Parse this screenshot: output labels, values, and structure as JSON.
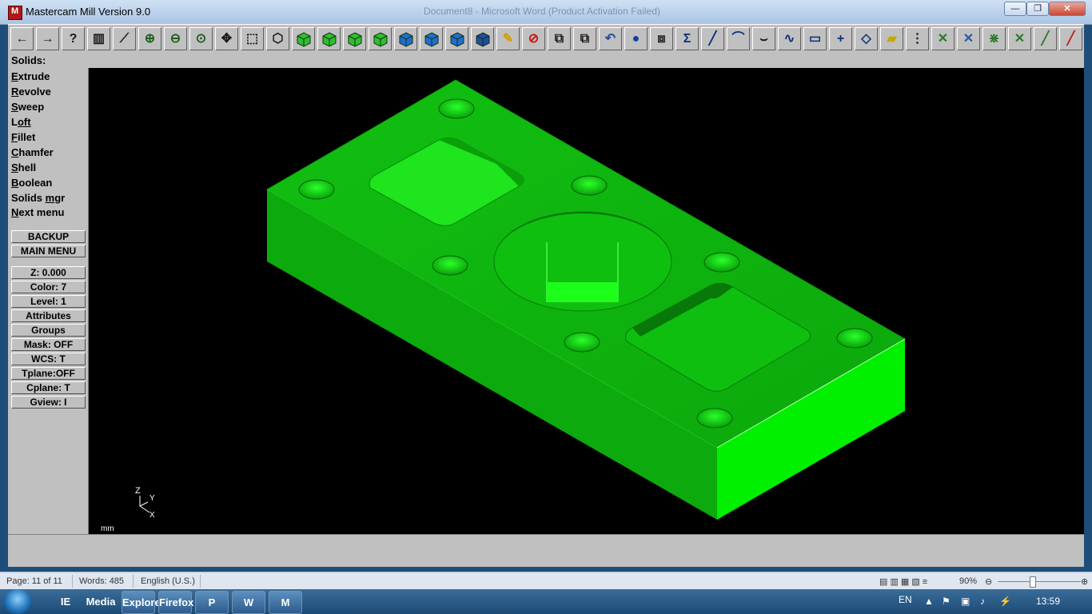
{
  "window": {
    "title": "Mastercam Mill Version 9.0",
    "background_title": "Document8 - Microsoft Word (Product Activation Failed)",
    "controls": [
      "—",
      "❐",
      "✕"
    ]
  },
  "toolbar": {
    "icons": [
      "back-arrow-icon",
      "forward-arrow-icon",
      "help-icon",
      "file-icon",
      "analyze-icon",
      "zoom-icon",
      "unzoom-icon",
      "zoom-fit-icon",
      "pan-icon",
      "select-window-icon",
      "view-top-icon",
      "cube-iso-icon",
      "cube-top-icon",
      "cube-front-icon",
      "cube-side-icon",
      "cube-blue-1-icon",
      "cube-blue-2-icon",
      "cube-blue-3-icon",
      "cube-outline-icon",
      "pencil-icon",
      "no-entry-icon",
      "transform-icon",
      "transform2-icon",
      "undo-icon",
      "sphere-icon",
      "layers-icon",
      "sigma-icon",
      "line-icon",
      "arc-icon",
      "trim-icon",
      "spline-icon",
      "rectangle-icon",
      "point-icon",
      "plane-icon",
      "box-icon",
      "tree-icon",
      "x-icon",
      "x2-icon",
      "x3-icon",
      "x4-icon",
      "dim-icon",
      "dim2-icon"
    ]
  },
  "prompt": {
    "label": "Solids:"
  },
  "menu": [
    {
      "label": "Extrude",
      "hot": "E",
      "rest": "xtrude"
    },
    {
      "label": "Revolve",
      "hot": "R",
      "rest": "evolve"
    },
    {
      "label": "Sweep",
      "hot": "S",
      "rest": "weep"
    },
    {
      "label": "Loft",
      "hot": "L",
      "rest": "oft"
    },
    {
      "label": "Fillet",
      "hot": "F",
      "rest": "illet"
    },
    {
      "label": "Chamfer",
      "hot": "C",
      "rest": "hamfer"
    },
    {
      "label": "Shell",
      "hot": "S",
      "rest": "hell"
    },
    {
      "label": "Boolean",
      "hot": "B",
      "rest": "oolean"
    },
    {
      "label": "Solids mgr",
      "pre": "Solids ",
      "hot": "m",
      "rest": "gr"
    },
    {
      "label": "Next menu",
      "hot": "N",
      "rest": "ext menu"
    }
  ],
  "buttons": {
    "backup": "BACKUP",
    "main_menu": "MAIN MENU"
  },
  "params": {
    "z": "Z:   0.000",
    "color": "Color:        7",
    "level": "Level:  1",
    "attributes": "Attributes",
    "groups": "Groups",
    "mask": "Mask:  OFF",
    "wcs": "WCS:   T",
    "tplane": "Tplane:OFF",
    "cplane": "Cplane:  T",
    "gview": "Gview:   I"
  },
  "viewport": {
    "axis_labels": {
      "z": "Z",
      "y": "Y",
      "x": "X"
    },
    "units": "mm",
    "part_color": "#00e000"
  },
  "wordstatus": {
    "page": "Page: 11 of 11",
    "words": "Words: 485",
    "language": "English (U.S.)",
    "zoom": "90%"
  },
  "taskbar": {
    "apps": [
      "IE",
      "Media",
      "Explorer",
      "Firefox",
      "P",
      "W",
      "M"
    ],
    "lang": "EN",
    "time": "13:59"
  }
}
